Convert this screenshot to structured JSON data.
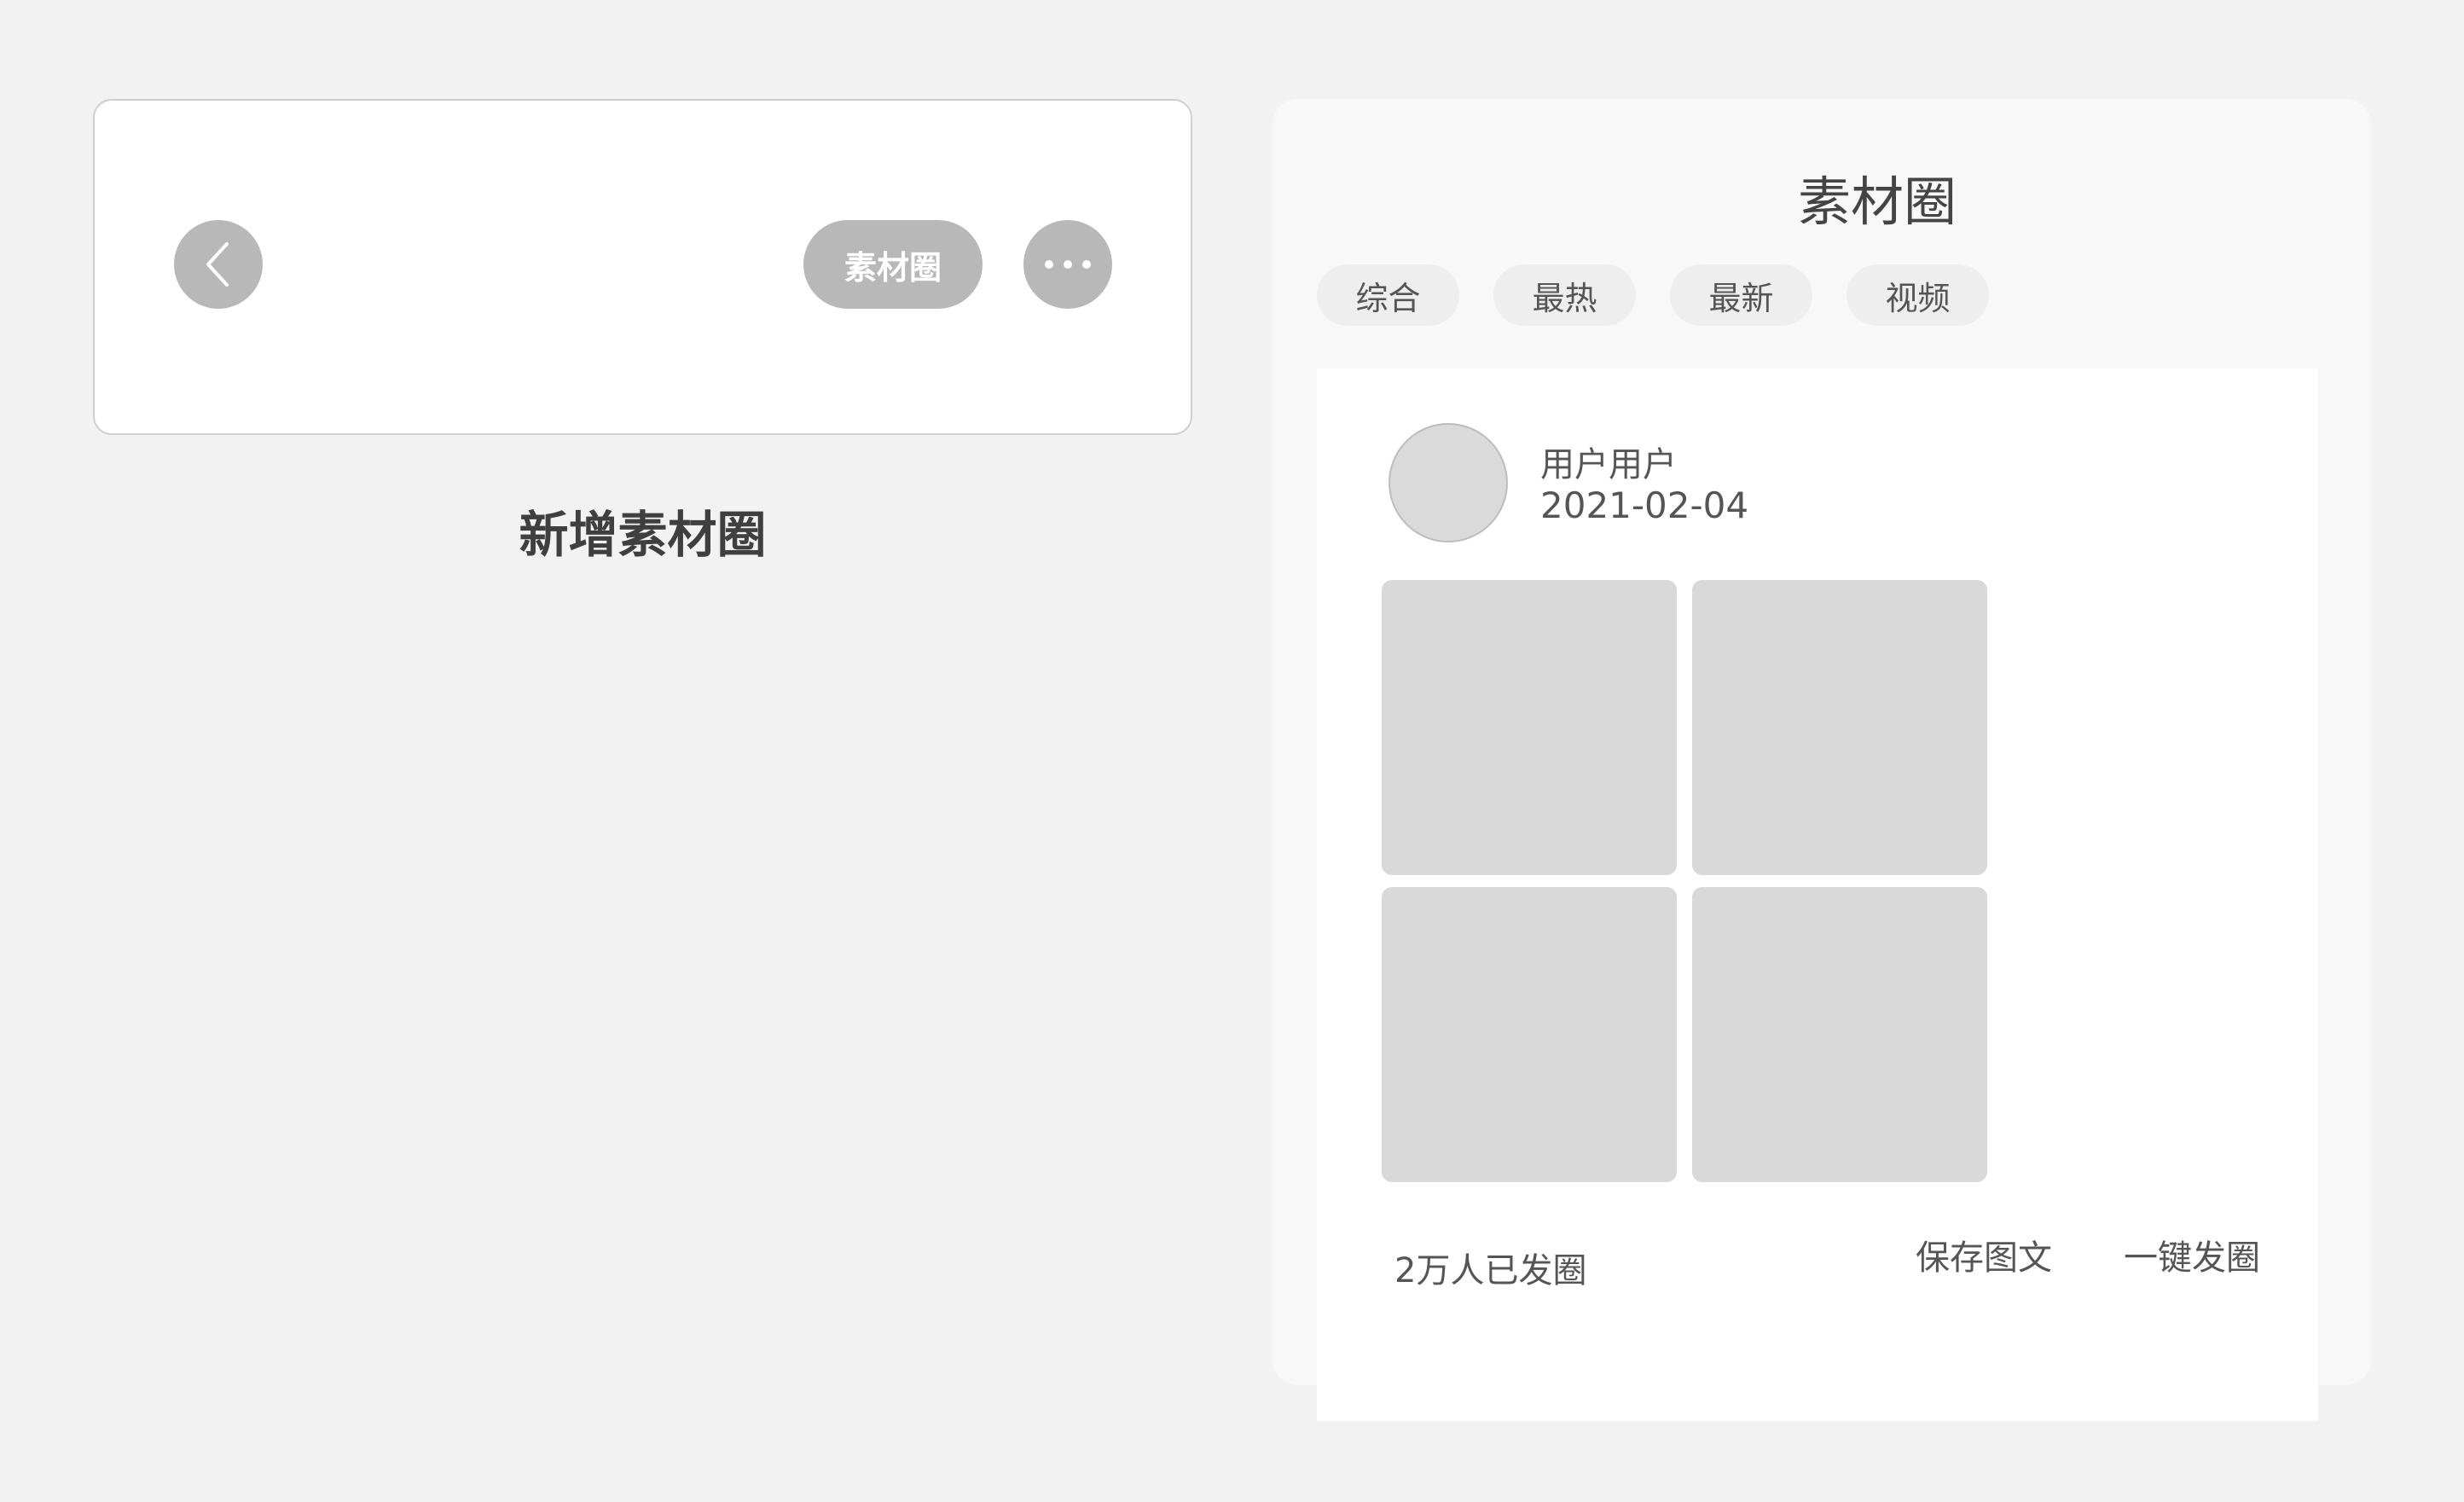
{
  "header_preview": {
    "back_icon": "chevron-left-icon",
    "pill_label": "素材圈",
    "more_icon": "more-dots-icon",
    "caption": "新增素材圈"
  },
  "material_page": {
    "title": "素材圈",
    "tabs": [
      {
        "label": "综合"
      },
      {
        "label": "最热"
      },
      {
        "label": "最新"
      },
      {
        "label": "视频"
      }
    ],
    "post": {
      "user_name": "用户用户",
      "date": "2021-02-04",
      "image_count": 4,
      "share_count": "2万人已发圈",
      "save_label": "保存图文",
      "post_label": "一键发圈"
    }
  },
  "colors": {
    "background": "#f2f2f2",
    "button_gray": "#b8b8b8",
    "placeholder_gray": "#d9d9d9"
  }
}
